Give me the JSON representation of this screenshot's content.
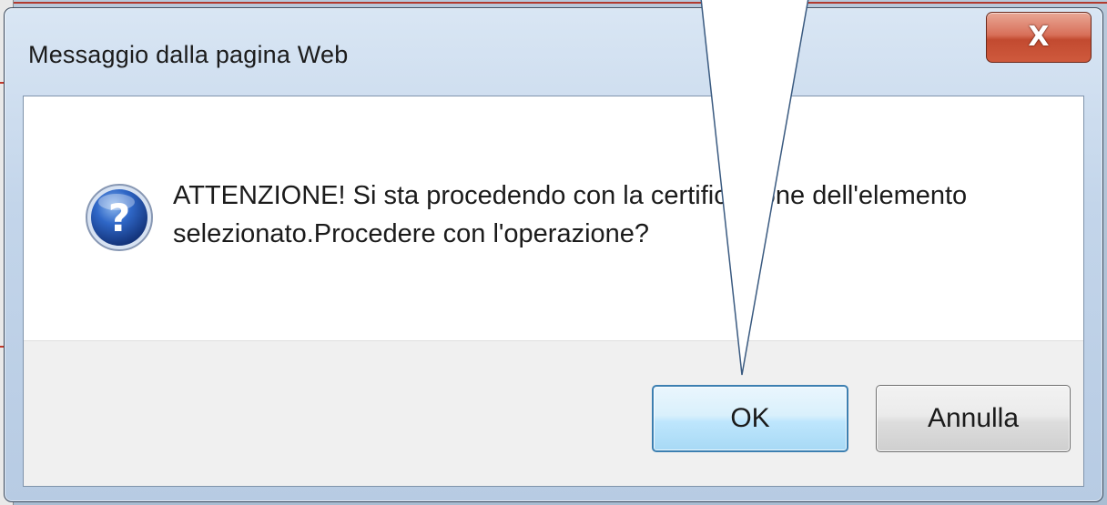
{
  "dialog": {
    "title": "Messaggio dalla pagina Web",
    "close_label": "X",
    "icon": "question-icon",
    "message": "ATTENZIONE! Si sta procedendo con la certificazione dell'elemento selezionato.Procedere con l'operazione?",
    "buttons": {
      "ok_label": "OK",
      "cancel_label": "Annulla"
    }
  },
  "annotation": {
    "type": "callout-pointer",
    "points_to": "ok-button",
    "color": "#ffffff",
    "stroke": "#3a5a80"
  }
}
